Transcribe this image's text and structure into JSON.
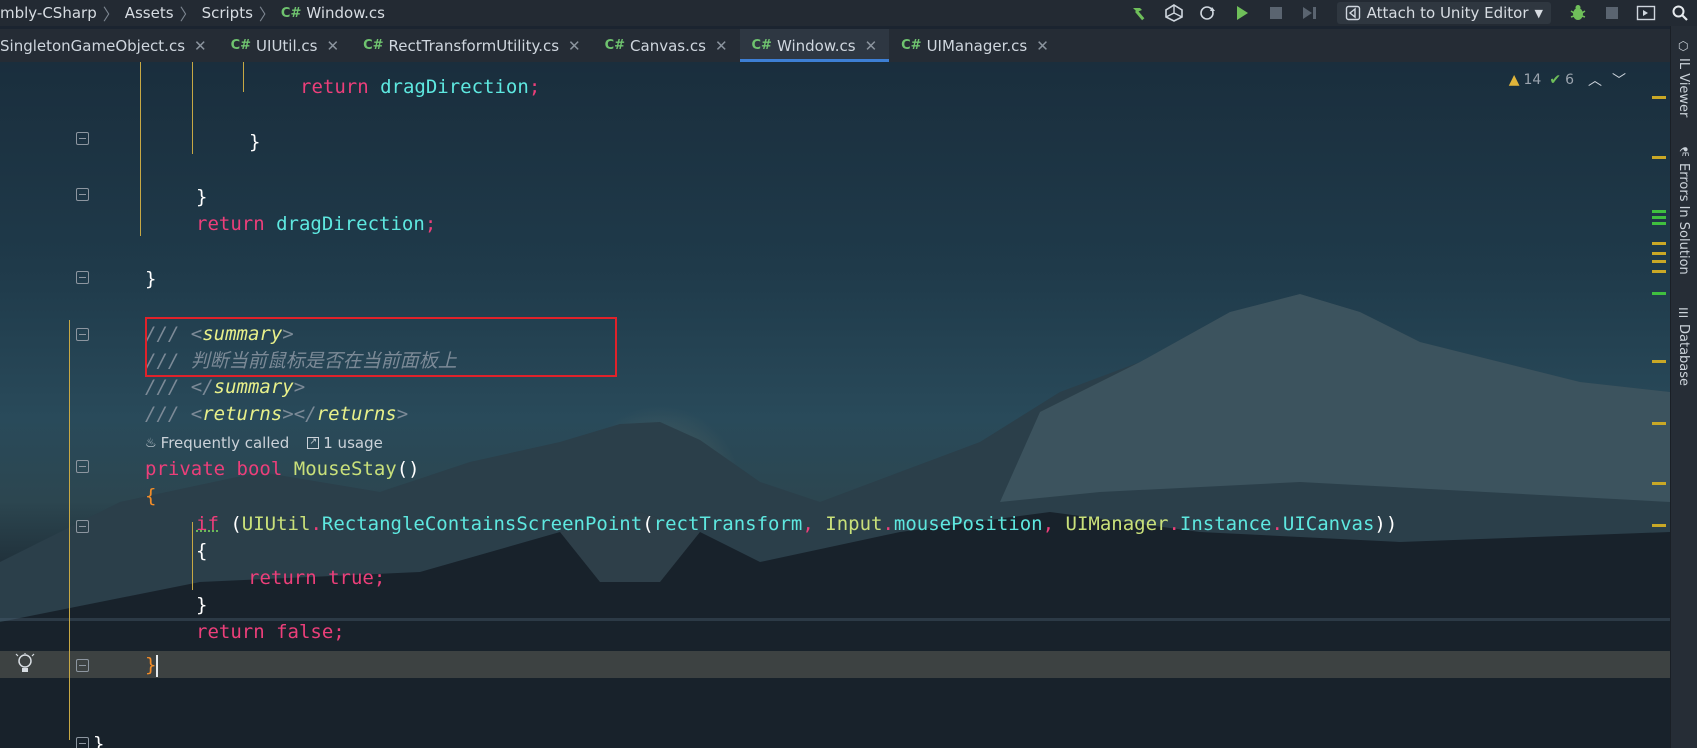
{
  "breadcrumb": {
    "items": [
      "mbly-CSharp",
      "Assets",
      "Scripts"
    ],
    "file_tag": "C#",
    "file": "Window.cs"
  },
  "toolbar": {
    "attach_label": "Attach to Unity Editor",
    "icons": [
      "hammer-icon",
      "unity-icon",
      "refresh-icon",
      "play-icon",
      "stop-icon",
      "step-icon",
      "bug-icon",
      "stop-icon",
      "panel-icon",
      "search-icon"
    ]
  },
  "tabs": [
    {
      "tag": "",
      "label": "SingletonGameObject.cs",
      "active": false
    },
    {
      "tag": "C#",
      "label": "UIUtil.cs",
      "active": false
    },
    {
      "tag": "C#",
      "label": "RectTransformUtility.cs",
      "active": false
    },
    {
      "tag": "C#",
      "label": "Canvas.cs",
      "active": false
    },
    {
      "tag": "C#",
      "label": "Window.cs",
      "active": true
    },
    {
      "tag": "C#",
      "label": "UIManager.cs",
      "active": false
    }
  ],
  "inspections": {
    "warnings": "14",
    "ok": "6"
  },
  "code": {
    "l1_kw": "return",
    "l1_id": "dragDirection",
    "l1_punc": ";",
    "l2_brace": "}",
    "l3_brace": "}",
    "l4_kw": "return",
    "l4_id": "dragDirection",
    "l4_punc": ";",
    "l5_brace": "}",
    "doc1_slash": "/// ",
    "doc1_tag": "summary",
    "doc2_slash": "/// ",
    "doc2_text": "判断当前鼠标是否在当前面板上",
    "doc3_slash": "/// ",
    "doc3_tag": "summary",
    "doc4_slash": "/// ",
    "doc4_tag_open": "returns",
    "doc4_tag_close": "returns",
    "hint_freq": "Frequently called",
    "hint_usage": "1 usage",
    "sig_private": "private",
    "sig_bool": "bool",
    "sig_name": "MouseStay",
    "sig_paren": "()",
    "open_brace": "{",
    "if_kw": "if",
    "if_a": "UIUtil",
    "if_b": "RectangleContainsScreenPoint",
    "if_c": "rectTransform",
    "if_d": "Input",
    "if_e": "mousePosition",
    "if_f": "UIManager",
    "if_g": "Instance",
    "if_h": "UICanvas",
    "inner_open": "{",
    "ret_true_kw": "return",
    "ret_true_val": "true",
    "inner_close": "}",
    "ret_false_kw": "return",
    "ret_false_val": "false",
    "close_brace": "}",
    "last_brace": "}"
  },
  "side_panel": {
    "labels": [
      "IL Viewer",
      "Errors In Solution",
      "Database"
    ]
  },
  "colors": {
    "keyword": "#ec3f7a",
    "identifier": "#5ee8e0",
    "type": "#c9e07a",
    "comment": "#7c8a97",
    "highlight_box": "#e0222a",
    "active_tab_underline": "#3d7fd4"
  }
}
